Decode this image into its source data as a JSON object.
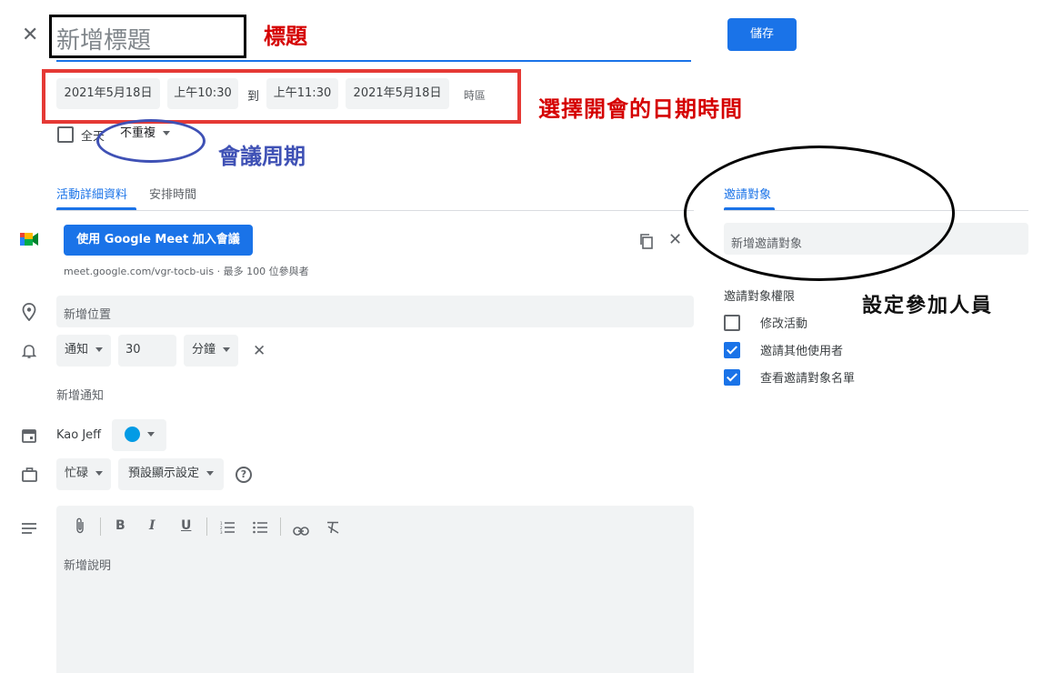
{
  "header": {
    "close_glyph": "✕",
    "title_placeholder": "新增標題",
    "save_label": "儲存"
  },
  "datetime": {
    "start_date": "2021年5月18日",
    "start_time": "上午10:30",
    "to_label": "到",
    "end_time": "上午11:30",
    "end_date": "2021年5月18日",
    "timezone_label": "時區",
    "all_day_label": "全天",
    "repeat_value": "不重複"
  },
  "tabs": {
    "details": "活動詳細資料",
    "schedule": "安排時間",
    "guests": "邀請對象"
  },
  "meet": {
    "join_button": "使用 Google Meet 加入會議",
    "link_text": "meet.google.com/vgr-tocb-uis · 最多 100 位參與者"
  },
  "location": {
    "placeholder": "新增位置"
  },
  "notification": {
    "type": "通知",
    "amount": "30",
    "unit": "分鐘",
    "add_label": "新增通知"
  },
  "calendar": {
    "owner": "Kao Jeff",
    "color": "#039be5"
  },
  "availability": {
    "status": "忙碌",
    "visibility": "預設顯示設定",
    "help_glyph": "?"
  },
  "description": {
    "placeholder": "新增說明",
    "toolbar": {
      "bold": "B",
      "italic": "I",
      "underline": "U"
    }
  },
  "guests": {
    "add_placeholder": "新增邀請對象",
    "permissions_title": "邀請對象權限",
    "permissions": [
      {
        "label": "修改活動",
        "checked": false
      },
      {
        "label": "邀請其他使用者",
        "checked": true
      },
      {
        "label": "查看邀請對象名單",
        "checked": true
      }
    ]
  },
  "annotations": {
    "title_note": "標題",
    "datetime_note": "選擇開會的日期時間",
    "repeat_note": "會議周期",
    "guests_note": "設定參加人員"
  },
  "colors": {
    "primary": "#1a73e8",
    "annot_red": "#d50000",
    "annot_blue": "#3f51b5",
    "field_bg": "#f1f3f4"
  }
}
